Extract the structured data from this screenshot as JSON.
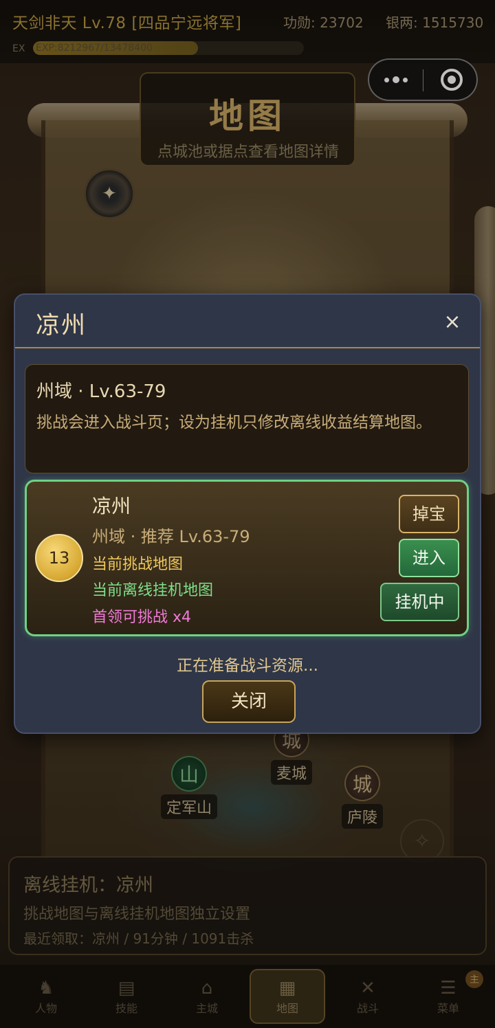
{
  "header": {
    "title": "天剑非天 Lv.78 [四品宁远将军]",
    "merit": "功勋: 23702",
    "silver": "银两: 1515730",
    "ex_label": "EX",
    "exp_text": "EXP:8212967/13478400",
    "exp_progress": 0.6093
  },
  "capsule": {
    "more_icon": "more-dots-icon",
    "close_icon": "target-close-icon"
  },
  "map_plate": {
    "title": "地图",
    "subtitle": "点城池或据点查看地图详情"
  },
  "markers": [
    {
      "glyph": "城",
      "label": "麦城",
      "type": "city"
    },
    {
      "glyph": "山",
      "label": "定军山",
      "type": "mountain"
    },
    {
      "glyph": "城",
      "label": "庐陵",
      "type": "city"
    }
  ],
  "idle_panel": {
    "title": "离线挂机：凉州",
    "description": "挑战地图与离线挂机地图独立设置",
    "recent": "最近领取：凉州 / 91分钟 / 1091击杀"
  },
  "bottom_nav": [
    {
      "label": "人物",
      "icon": "character-icon"
    },
    {
      "label": "技能",
      "icon": "skill-book-icon"
    },
    {
      "label": "主城",
      "icon": "city-icon"
    },
    {
      "label": "地图",
      "icon": "map-scroll-icon",
      "active": true
    },
    {
      "label": "战斗",
      "icon": "crossed-swords-icon"
    },
    {
      "label": "菜单",
      "icon": "menu-icon",
      "badge": "主"
    }
  ],
  "modal": {
    "title": "凉州",
    "close_symbol": "×",
    "info": {
      "line1": "州域 · Lv.63-79",
      "line2": "挑战会进入战斗页；设为挂机只修改离线收益结算地图。"
    },
    "card": {
      "level": "13",
      "name": "凉州",
      "meta": "州域  ·  推荐 Lv.63-79",
      "status_challenge": "当前挑战地图",
      "status_idle": "当前离线挂机地图",
      "boss": "首领可挑战 x4",
      "btn_loot": "掉宝",
      "btn_enter": "进入",
      "btn_idle": "挂机中"
    },
    "status": "正在准备战斗资源...",
    "close_button": "关闭"
  },
  "colors": {
    "accent_gold": "#c7a560",
    "modal_bg": "#2f3648",
    "card_border": "#6fd284",
    "boss_text": "#f07ad6"
  }
}
